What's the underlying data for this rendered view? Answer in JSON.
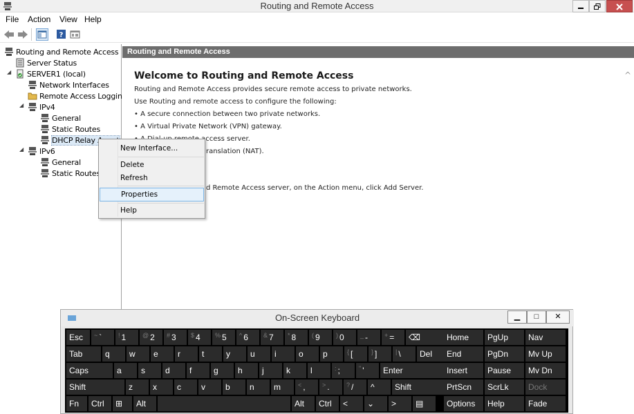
{
  "window": {
    "title": "Routing and Remote Access",
    "icon": "rras-icon",
    "controls": [
      "minimize-icon",
      "maximize-icon",
      "close-icon"
    ],
    "close_color": "#c75050"
  },
  "menubar": {
    "items": [
      "File",
      "Action",
      "View",
      "Help"
    ]
  },
  "toolbar": {
    "buttons": [
      "back-arrow-icon",
      "forward-arrow-icon",
      "show-hide-tree-icon",
      "help-icon",
      "console-icon"
    ]
  },
  "tree": {
    "items": [
      {
        "label": "Routing and Remote Access",
        "icon": "rras-icon"
      },
      {
        "label": "Server Status",
        "icon": "server-status-icon"
      },
      {
        "label": "SERVER1 (local)",
        "icon": "server-icon"
      },
      {
        "label": "Network Interfaces",
        "icon": "network-icon"
      },
      {
        "label": "Remote Access Logging",
        "icon": "folder-icon"
      },
      {
        "label": "IPv4",
        "icon": "network-icon"
      },
      {
        "label": "General",
        "icon": "network-icon"
      },
      {
        "label": "Static Routes",
        "icon": "network-icon"
      },
      {
        "label": "DHCP Relay Agent",
        "icon": "network-icon"
      },
      {
        "label": "IPv6",
        "icon": "network-icon"
      },
      {
        "label": "General",
        "icon": "network-icon"
      },
      {
        "label": "Static Routes",
        "icon": "network-icon"
      }
    ]
  },
  "content": {
    "header": "Routing and Remote Access",
    "heading": "Welcome to Routing and Remote Access",
    "lines": [
      "Routing and Remote Access provides secure remote access to private networks.",
      "Use Routing and remote access to configure the following:",
      "• A secure connection between two private networks.",
      "• A Virtual Private Network (VPN) gateway.",
      "• A Dial-up remote access server.",
      "ranslation (NAT).",
      "d Remote Access server, on the Action menu, click Add Server."
    ]
  },
  "context_menu": {
    "items": [
      "New Interface...",
      "Delete",
      "Refresh",
      "Properties",
      "Help"
    ],
    "highlighted": "Properties",
    "highlight_color": "#e5f1fb"
  },
  "osk": {
    "title": "On-Screen Keyboard",
    "controls": [
      "minimize-icon",
      "restore-icon",
      "close-icon"
    ],
    "rows": [
      [
        {
          "l": "Esc"
        },
        {
          "s": "~",
          "l": "`"
        },
        {
          "s": "!",
          "l": "1"
        },
        {
          "s": "@",
          "l": "2"
        },
        {
          "s": "#",
          "l": "3"
        },
        {
          "s": "$",
          "l": "4"
        },
        {
          "s": "%",
          "l": "5"
        },
        {
          "s": "^",
          "l": "6"
        },
        {
          "s": "&",
          "l": "7"
        },
        {
          "s": "*",
          "l": "8"
        },
        {
          "s": "(",
          "l": "9"
        },
        {
          "s": ")",
          "l": "0"
        },
        {
          "s": "_",
          "l": "-"
        },
        {
          "s": "+",
          "l": "="
        },
        {
          "l": "⌫"
        },
        {
          "l": "Home"
        },
        {
          "l": "PgUp"
        },
        {
          "l": "Nav"
        }
      ],
      [
        {
          "l": "Tab"
        },
        {
          "l": "q"
        },
        {
          "l": "w"
        },
        {
          "l": "e"
        },
        {
          "l": "r"
        },
        {
          "l": "t"
        },
        {
          "l": "y"
        },
        {
          "l": "u"
        },
        {
          "l": "i"
        },
        {
          "l": "o"
        },
        {
          "l": "p"
        },
        {
          "s": "{",
          "l": "["
        },
        {
          "s": "}",
          "l": "]"
        },
        {
          "s": "|",
          "l": "\\"
        },
        {
          "l": "Del"
        },
        {
          "l": "End"
        },
        {
          "l": "PgDn"
        },
        {
          "l": "Mv Up"
        }
      ],
      [
        {
          "l": "Caps"
        },
        {
          "l": "a"
        },
        {
          "l": "s"
        },
        {
          "l": "d"
        },
        {
          "l": "f"
        },
        {
          "l": "g"
        },
        {
          "l": "h"
        },
        {
          "l": "j"
        },
        {
          "l": "k"
        },
        {
          "l": "l"
        },
        {
          "s": ":",
          "l": ";"
        },
        {
          "s": "\"",
          "l": "'"
        },
        {
          "l": "Enter"
        },
        {
          "l": "Insert"
        },
        {
          "l": "Pause"
        },
        {
          "l": "Mv Dn"
        }
      ],
      [
        {
          "l": "Shift"
        },
        {
          "l": "z"
        },
        {
          "l": "x"
        },
        {
          "l": "c"
        },
        {
          "l": "v"
        },
        {
          "l": "b"
        },
        {
          "l": "n"
        },
        {
          "l": "m"
        },
        {
          "s": "<",
          "l": ","
        },
        {
          "s": ">",
          "l": "."
        },
        {
          "s": "?",
          "l": "/"
        },
        {
          "l": "^"
        },
        {
          "l": "Shift"
        },
        {
          "l": "PrtScn"
        },
        {
          "l": "ScrLk"
        },
        {
          "l": "Dock"
        }
      ],
      [
        {
          "l": "Fn"
        },
        {
          "l": "Ctrl"
        },
        {
          "l": "⊞"
        },
        {
          "l": "Alt"
        },
        {
          "l": ""
        },
        {
          "l": "Alt"
        },
        {
          "l": "Ctrl"
        },
        {
          "l": "<"
        },
        {
          "l": "⌄"
        },
        {
          "l": ">"
        },
        {
          "l": "▤"
        },
        {
          "l": "Options"
        },
        {
          "l": "Help"
        },
        {
          "l": "Fade"
        }
      ]
    ]
  }
}
